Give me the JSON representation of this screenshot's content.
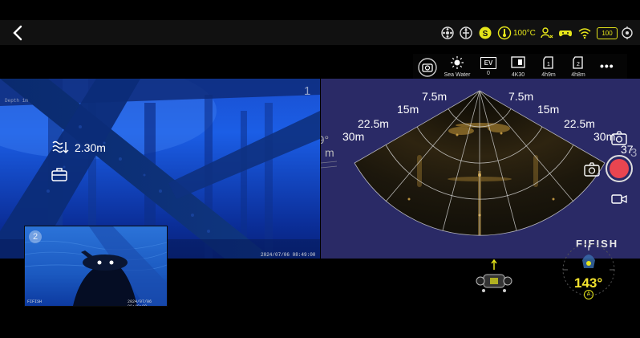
{
  "status_bar": {
    "temperature": "100°C",
    "battery_level": "100",
    "icons": [
      "propeller-icon",
      "navigation-icon",
      "s-mode-icon",
      "thermometer-icon",
      "user-connect-icon",
      "gamepad-icon",
      "wifi-icon",
      "battery-icon",
      "settings-icon"
    ],
    "accent_color": "#e6e61a"
  },
  "toolbar": {
    "scene_label": "Sea Water",
    "ev_label": "EV",
    "ev_value": "0",
    "resolution_label": "4K30",
    "storage_1": "4h9m",
    "storage_2": "4h8m",
    "storage_1_badge": "1",
    "storage_2_badge": "2",
    "more_label": "•••"
  },
  "main_camera": {
    "channel": "1",
    "depth": "2.30m",
    "overlay_text": "Depth  1m",
    "timestamp": "2024/07/06 08:49:00"
  },
  "pip_camera": {
    "channel": "2",
    "logo": "FIFISH",
    "timestamp": "2024/07/06 08:49:00"
  },
  "sonar": {
    "channel": "3",
    "range_labels": {
      "r1": "7.5m",
      "r2": "15m",
      "r3": "22.5m",
      "r4": "30m",
      "r5": "37",
      "r_edge": "m"
    },
    "tilt_label": "-9°",
    "colors": {
      "background": "#2a2a66",
      "fan_fill": "#1a1508",
      "echo": "#c89a3a"
    }
  },
  "right_controls": {
    "record_color": "#e94550"
  },
  "heading": {
    "value": "143°",
    "mode_icon": "A"
  },
  "branding": {
    "logo": "FIFISH"
  }
}
